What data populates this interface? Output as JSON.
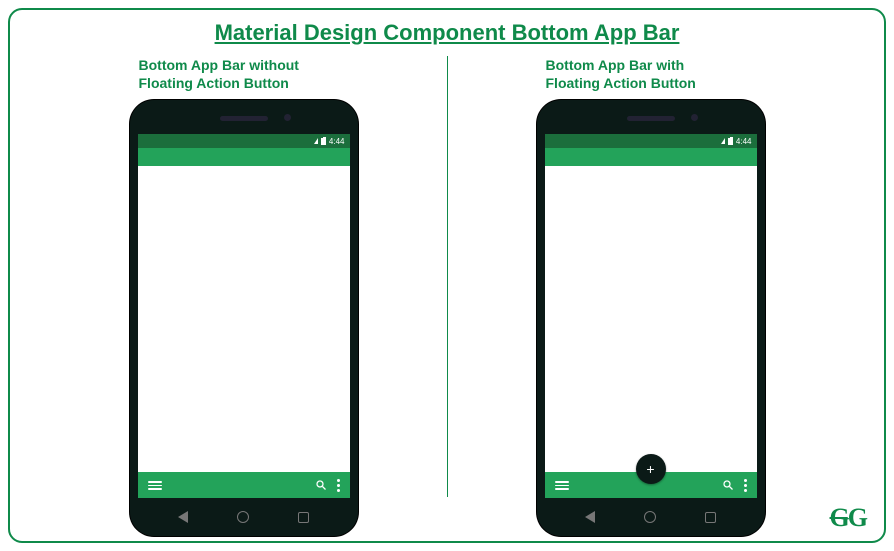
{
  "title": "Material Design Component Bottom App Bar",
  "left": {
    "caption_line1": "Bottom App Bar without",
    "caption_line2": "Floating Action Button"
  },
  "right": {
    "caption_line1": "Bottom App Bar with",
    "caption_line2": "Floating Action Button"
  },
  "status": {
    "time": "4:44"
  },
  "fab": {
    "symbol": "+"
  },
  "logo": {
    "g1": "G",
    "g2": "G"
  },
  "colors": {
    "brand": "#0f8a4a",
    "status_bar": "#1b6e3c",
    "app_bar": "#23a35a",
    "phone_body": "#0b1a17"
  }
}
